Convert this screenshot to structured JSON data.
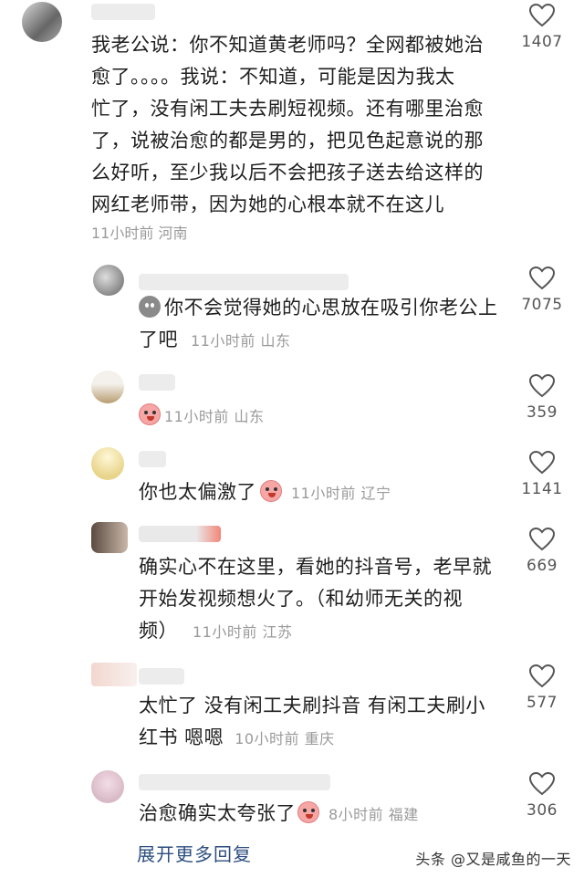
{
  "comments": [
    {
      "text_lines": [
        "我老公说：你不知道黄老师吗？全网都被她治",
        "愈了。。。。我说：不知道，可能是因为我太",
        "忙了，没有闲工夫去刷短视频。还有哪里治愈",
        "了，说被治愈的都是男的，把见色起意说的那",
        "么好听，至少我以后不会把孩子送去给这样的",
        "网红老师带，因为她的心根本就不在这儿"
      ],
      "time": "11小时前",
      "location": "河南",
      "likes": "1407"
    },
    {
      "text_lines": [
        "你不会觉得她的心思放在吸引你老公上",
        "了吧"
      ],
      "time": "11小时前",
      "location": "山东",
      "likes": "7075"
    },
    {
      "text_lines": [],
      "time": "11小时前",
      "location": "山东",
      "likes": "359"
    },
    {
      "text_lines": [
        "你也太偏激了"
      ],
      "time": "11小时前",
      "location": "辽宁",
      "likes": "1141"
    },
    {
      "text_lines": [
        "确实心不在这里，看她的抖音号，老早就",
        "开始发视频想火了。（和幼师无关的视",
        "频）"
      ],
      "time": "11小时前",
      "location": "江苏",
      "likes": "669"
    },
    {
      "text_lines": [
        "太忙了 没有闲工夫刷抖音 有闲工夫刷小",
        "红书 嗯嗯"
      ],
      "time": "10小时前",
      "location": "重庆",
      "likes": "577"
    },
    {
      "text_lines": [
        "治愈确实太夸张了"
      ],
      "time": "8小时前",
      "location": "福建",
      "likes": "306"
    }
  ],
  "expand_more": "展开更多回复",
  "watermark": "头条 @又是咸鱼的一天",
  "colors": {
    "link": "#2d4e7f",
    "meta": "#9a9a9a",
    "text": "#1f1f1f"
  },
  "icons": [
    "heart-icon",
    "emoji-icon",
    "avatar"
  ]
}
